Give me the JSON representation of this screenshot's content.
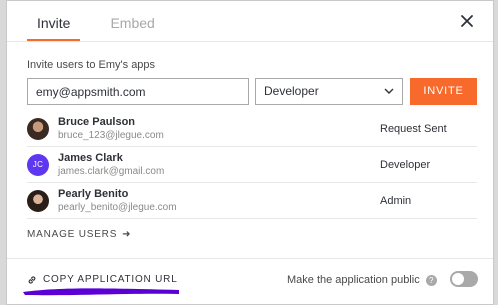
{
  "tabs": [
    {
      "label": "Invite",
      "active": true
    },
    {
      "label": "Embed",
      "active": false
    }
  ],
  "invite": {
    "label": "Invite users to Emy's apps",
    "email_value": "emy@appsmith.com",
    "role_value": "Developer",
    "button_label": "INVITE"
  },
  "users": [
    {
      "name": "Bruce Paulson",
      "email": "bruce_123@jlegue.com",
      "role": "Request Sent",
      "avatar": "photo"
    },
    {
      "name": "James Clark",
      "email": "james.clark@gmail.com",
      "role": "Developer",
      "avatar": "initials",
      "initials": "JC"
    },
    {
      "name": "Pearly Benito",
      "email": "pearly_benito@jlegue.com",
      "role": "Admin",
      "avatar": "photo"
    }
  ],
  "manage_users": {
    "label": "MANAGE USERS",
    "arrow": "➜"
  },
  "footer": {
    "copy_url_label": "COPY APPLICATION URL",
    "public_label": "Make the application public",
    "help_glyph": "?",
    "public_enabled": false
  },
  "colors": {
    "accent": "#f86a2b",
    "avatar_initials_bg": "#5d38f0",
    "redaction": "#5a00d6"
  },
  "icons": {
    "close": "close-icon",
    "dropdown": "chevron-down-icon",
    "link": "link-icon",
    "help": "help-icon",
    "arrow": "arrow-right-icon"
  }
}
